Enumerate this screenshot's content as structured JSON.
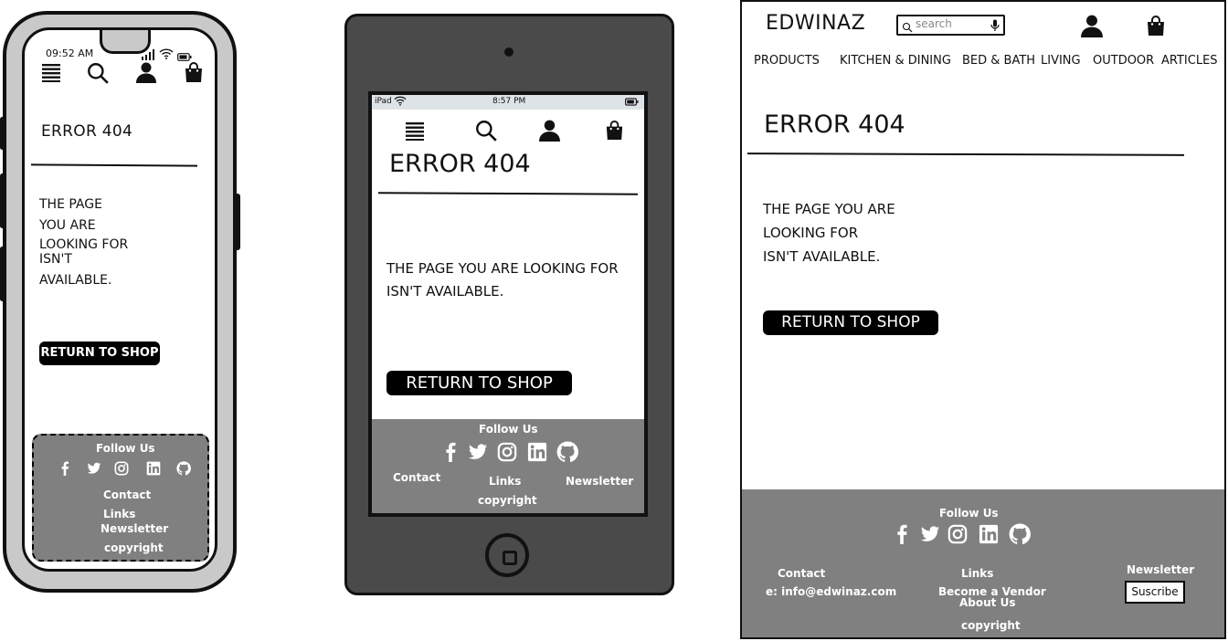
{
  "phone": {
    "status_time": "09:52 AM",
    "error_title": "ERROR 404",
    "message_lines": [
      "THE PAGE",
      "YOU ARE",
      "LOOKING FOR",
      "ISN'T",
      "AVAILABLE."
    ],
    "button_label": "RETURN TO SHOP",
    "footer": {
      "follow_label": "Follow Us",
      "contact_label": "Contact",
      "links_label": "Links",
      "newsletter_label": "Newsletter",
      "copyright_label": "copyright"
    }
  },
  "tablet": {
    "status_device": "iPad",
    "status_time": "8:57 PM",
    "error_title": "ERROR 404",
    "message_lines": [
      "THE PAGE YOU ARE LOOKING FOR",
      "ISN'T AVAILABLE."
    ],
    "button_label": "RETURN TO SHOP",
    "footer": {
      "follow_label": "Follow Us",
      "contact_label": "Contact",
      "links_label": "Links",
      "newsletter_label": "Newsletter",
      "copyright_label": "copyright"
    }
  },
  "desktop": {
    "logo": "EDWINAZ",
    "search_placeholder": "search",
    "nav": [
      "PRODUCTS",
      "KITCHEN & DINING",
      "BED & BATH",
      "LIVING",
      "OUTDOOR",
      "ARTICLES"
    ],
    "error_title": "ERROR 404",
    "message_lines": [
      "THE PAGE YOU ARE",
      "LOOKING FOR",
      "ISN'T AVAILABLE."
    ],
    "button_label": "RETURN TO SHOP",
    "footer": {
      "follow_label": "Follow Us",
      "contact_label": "Contact",
      "contact_email": "e: info@edwinaz.com",
      "links_label": "Links",
      "links_items": [
        "Become a Vendor",
        "About Us"
      ],
      "newsletter_label": "Newsletter",
      "subscribe_label": "Suscribe",
      "copyright_label": "copyright"
    }
  },
  "icons": {
    "social": [
      "facebook-icon",
      "twitter-icon",
      "instagram-icon",
      "linkedin-icon",
      "github-icon"
    ],
    "header": [
      "menu-icon",
      "search-icon",
      "user-icon",
      "bag-icon"
    ]
  },
  "colors": {
    "frame_gray": "#c9c9c9",
    "tablet_body": "#4a4a4a",
    "footer_gray": "#808080",
    "button_black": "#000000"
  }
}
